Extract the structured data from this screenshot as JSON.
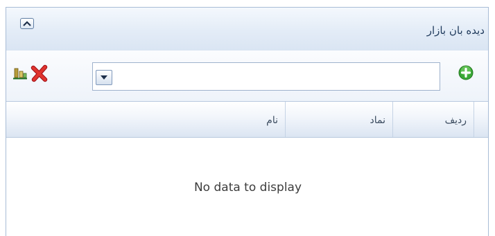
{
  "panel": {
    "title": "دیده بان بازار"
  },
  "header": {
    "collapse_icon": "chevron-up-icon"
  },
  "toolbar": {
    "chart_icon": "bar-chart-icon",
    "remove_icon": "red-x-icon",
    "add_icon": "green-plus-icon",
    "symbol_input": {
      "value": "",
      "placeholder": ""
    },
    "dropdown_icon": "triangle-down-icon"
  },
  "grid": {
    "columns": [
      "ردیف",
      "نماد",
      "نام"
    ],
    "empty_text": "No data to display"
  },
  "colors": {
    "header_bg": "#dbe6f4",
    "border": "#a8bcd6",
    "title_text": "#1e395b",
    "remove_red": "#d8232a",
    "add_green": "#38a635"
  }
}
